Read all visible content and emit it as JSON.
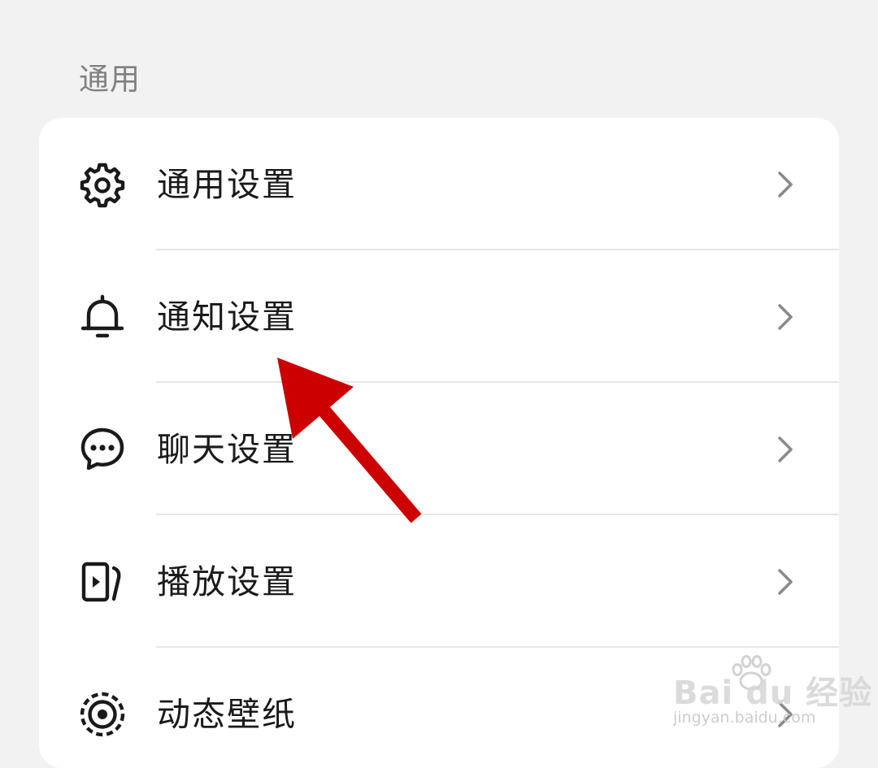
{
  "section": {
    "title": "通用"
  },
  "settings": {
    "items": [
      {
        "label": "通用设置",
        "icon": "gear-icon"
      },
      {
        "label": "通知设置",
        "icon": "bell-icon"
      },
      {
        "label": "聊天设置",
        "icon": "chat-bubble-icon"
      },
      {
        "label": "播放设置",
        "icon": "video-play-icon"
      },
      {
        "label": "动态壁纸",
        "icon": "live-wallpaper-icon"
      }
    ]
  },
  "annotation": {
    "arrow_color": "#cc0000"
  },
  "watermark": {
    "logo": "Bai du 经验",
    "url": "jingyan.baidu.com"
  },
  "colors": {
    "background": "#f2f2f2",
    "card": "#ffffff",
    "text": "#1a1a1a",
    "section_header": "#808080",
    "chevron": "#8a8a8a",
    "divider": "#e6e6e6"
  }
}
